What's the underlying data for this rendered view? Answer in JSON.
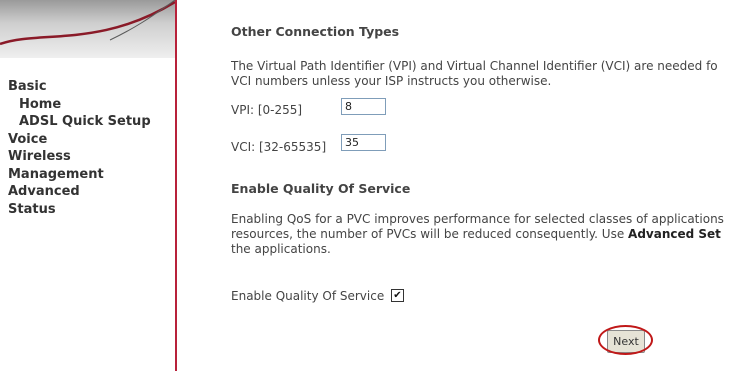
{
  "sidebar": {
    "items": [
      {
        "label": "Basic",
        "level": 0
      },
      {
        "label": "Home",
        "level": 1
      },
      {
        "label": "ADSL Quick Setup",
        "level": 1
      },
      {
        "label": "Voice",
        "level": 0
      },
      {
        "label": "Wireless",
        "level": 0
      },
      {
        "label": "Management",
        "level": 0
      },
      {
        "label": "Advanced",
        "level": 0
      },
      {
        "label": "Status",
        "level": 0
      }
    ]
  },
  "main": {
    "section1_title": "Other Connection Types",
    "section1_line1": "The Virtual Path Identifier (VPI) and Virtual Channel Identifier (VCI) are needed fo",
    "section1_line2": "VCI numbers unless your ISP instructs you otherwise.",
    "vpi_label": "VPI: [0-255]",
    "vpi_value": "8",
    "vci_label": "VCI: [32-65535]",
    "vci_value": "35",
    "section2_title": "Enable Quality Of Service",
    "section2_line1": "Enabling QoS for a PVC improves performance for selected classes of applications",
    "section2_line2a": "resources, the number of PVCs will be reduced consequently. Use ",
    "section2_line2b": "Advanced Set",
    "section2_line3": "the applications.",
    "qos_label": "Enable Quality Of Service",
    "qos_checked": true,
    "next_label": "Next"
  },
  "colors": {
    "sidebar_border": "#b8213a",
    "highlight_circle": "#c01818"
  }
}
